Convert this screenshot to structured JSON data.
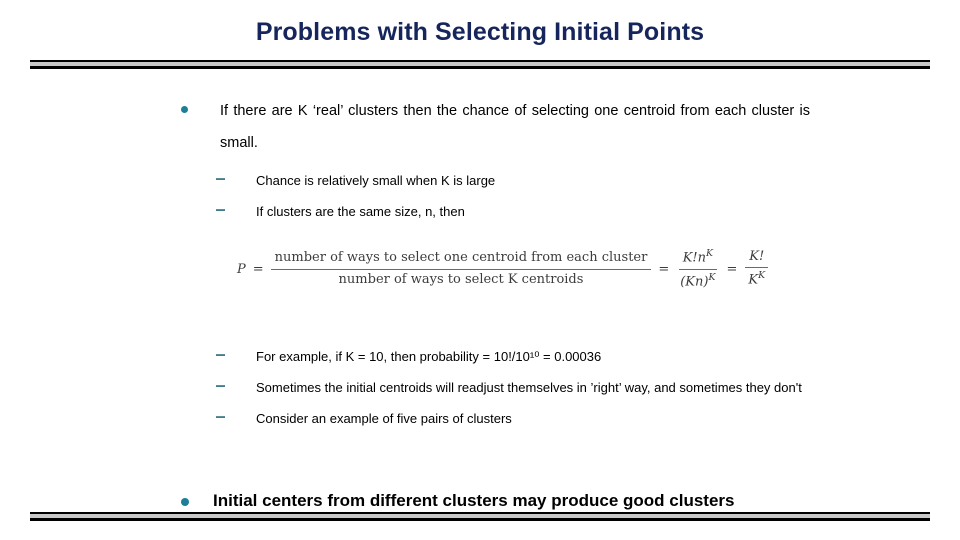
{
  "slide": {
    "title": "Problems with Selecting Initial Points",
    "title_color": "#16265c",
    "bullet_color": "#1b7f95"
  },
  "bullets": {
    "main_1": "If there are K ‘real’ clusters then the chance of selecting one centroid from each cluster is small.",
    "sub_1": "Chance is relatively small when K is large",
    "sub_2": "If clusters are the same size, n, then",
    "sub_3": "For example, if K = 10, then probability = 10!/10¹⁰ = 0.00036",
    "sub_4": "Sometimes the initial centroids will readjust themselves in ’right’ way, and sometimes they don't",
    "sub_5": "Consider an example of five pairs of clusters",
    "main_2": "Initial centers from different clusters may produce good clusters"
  },
  "formula": {
    "lhs_symbol": "P",
    "eq1": "=",
    "numerator": "number of ways to select one centroid from each cluster",
    "denominator": "number of ways to select K centroids",
    "eq2": "=",
    "frac2_num": "K!n",
    "frac2_num_sup": "K",
    "frac2_den": "(Kn)",
    "frac2_den_sup": "K",
    "eq3": "=",
    "frac3_num": "K!",
    "frac3_den": "K",
    "frac3_den_sup": "K"
  }
}
